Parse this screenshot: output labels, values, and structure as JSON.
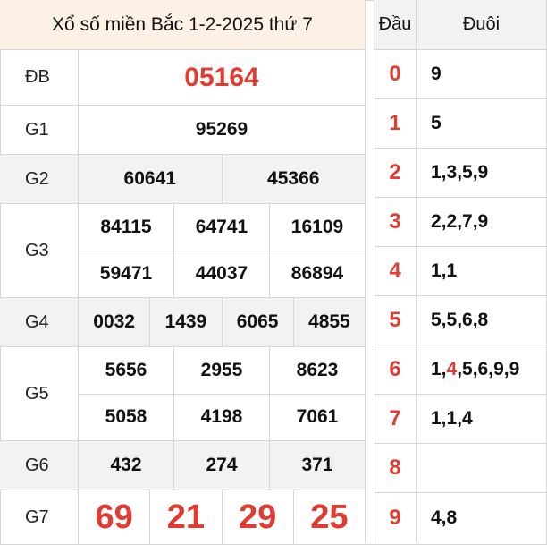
{
  "title": "Xổ số miền Bắc 1-2-2025 thứ 7",
  "prizes": [
    {
      "label": "ĐB",
      "rows": [
        [
          "05164"
        ]
      ]
    },
    {
      "label": "G1",
      "rows": [
        [
          "95269"
        ]
      ]
    },
    {
      "label": "G2",
      "rows": [
        [
          "60641",
          "45366"
        ]
      ]
    },
    {
      "label": "G3",
      "rows": [
        [
          "84115",
          "64741",
          "16109"
        ],
        [
          "59471",
          "44037",
          "86894"
        ]
      ]
    },
    {
      "label": "G4",
      "rows": [
        [
          "0032",
          "1439",
          "6065",
          "4855"
        ]
      ]
    },
    {
      "label": "G5",
      "rows": [
        [
          "5656",
          "2955",
          "8623"
        ],
        [
          "5058",
          "4198",
          "7061"
        ]
      ]
    },
    {
      "label": "G6",
      "rows": [
        [
          "432",
          "274",
          "371"
        ]
      ]
    },
    {
      "label": "G7",
      "rows": [
        [
          "69",
          "21",
          "29",
          "25"
        ]
      ]
    }
  ],
  "loto": {
    "head_label": "Đầu",
    "tail_label": "Đuôi",
    "rows": [
      {
        "dau": "0",
        "duoi": "9"
      },
      {
        "dau": "1",
        "duoi": "5"
      },
      {
        "dau": "2",
        "duoi": "1,3,5,9"
      },
      {
        "dau": "3",
        "duoi": "2,2,7,9"
      },
      {
        "dau": "4",
        "duoi": "1,1"
      },
      {
        "dau": "5",
        "duoi": "5,5,6,8"
      },
      {
        "dau": "6",
        "duoi_pre": "1,",
        "duoi_hl": "4",
        "duoi_post": ",5,6,9,9"
      },
      {
        "dau": "7",
        "duoi": "1,1,4"
      },
      {
        "dau": "8",
        "duoi": ""
      },
      {
        "dau": "9",
        "duoi": "4,8"
      }
    ]
  },
  "colors": {
    "accent_red": "#e03c31",
    "title_bg": "#fdf0e5",
    "stripe": "#f2f2f2"
  }
}
